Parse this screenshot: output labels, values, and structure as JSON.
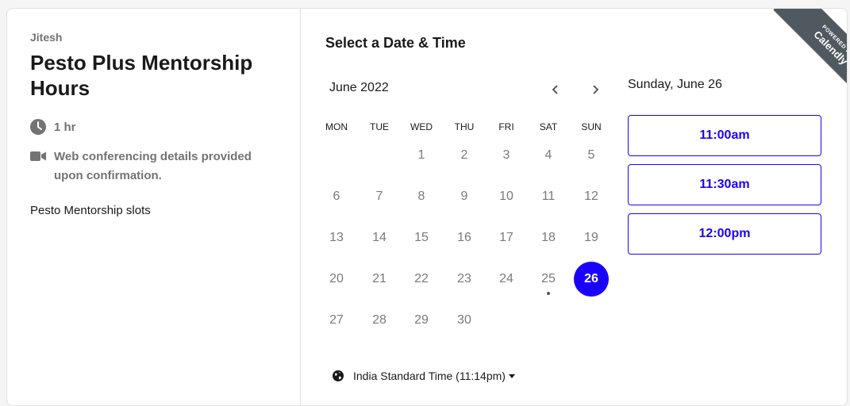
{
  "host": "Jitesh",
  "event": {
    "title": "Pesto Plus Mentorship Hours",
    "duration": "1 hr",
    "conferencing": "Web conferencing details provided upon confirmation.",
    "description": "Pesto Mentorship slots"
  },
  "calendar": {
    "section_title": "Select a Date & Time",
    "month_label": "June 2022",
    "weekdays": [
      "MON",
      "TUE",
      "WED",
      "THU",
      "FRI",
      "SAT",
      "SUN"
    ],
    "weeks": [
      [
        "",
        "",
        "1",
        "2",
        "3",
        "4",
        "5"
      ],
      [
        "6",
        "7",
        "8",
        "9",
        "10",
        "11",
        "12"
      ],
      [
        "13",
        "14",
        "15",
        "16",
        "17",
        "18",
        "19"
      ],
      [
        "20",
        "21",
        "22",
        "23",
        "24",
        "25",
        "26"
      ],
      [
        "27",
        "28",
        "29",
        "30",
        "",
        "",
        ""
      ]
    ],
    "selected_day": "26",
    "today_marker_day": "25",
    "icons": {
      "prev": "chevron-left-icon",
      "next": "chevron-right-icon"
    }
  },
  "timezone": {
    "label": "India Standard Time (11:14pm)",
    "icon": "globe-icon"
  },
  "times": {
    "selected_date_label": "Sunday, June 26",
    "slots": [
      "11:00am",
      "11:30am",
      "12:00pm"
    ]
  },
  "ribbon": {
    "powered_by": "POWERED BY",
    "brand": "Calendly"
  },
  "colors": {
    "accent": "#1a00ff",
    "muted_text": "#737373",
    "ribbon": "#505960"
  }
}
